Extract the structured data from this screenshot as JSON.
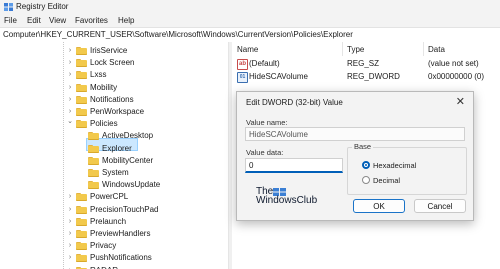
{
  "window": {
    "title": "Registry Editor"
  },
  "menu": [
    "File",
    "Edit",
    "View",
    "Favorites",
    "Help"
  ],
  "address": "Computer\\HKEY_CURRENT_USER\\Software\\Microsoft\\Windows\\CurrentVersion\\Policies\\Explorer",
  "tree": [
    {
      "label": "IrisService",
      "level": 0,
      "expanded": false
    },
    {
      "label": "Lock Screen",
      "level": 0,
      "expanded": false
    },
    {
      "label": "Lxss",
      "level": 0,
      "expanded": false
    },
    {
      "label": "Mobility",
      "level": 0,
      "expanded": false
    },
    {
      "label": "Notifications",
      "level": 0,
      "expanded": false
    },
    {
      "label": "PenWorkspace",
      "level": 0,
      "expanded": false
    },
    {
      "label": "Policies",
      "level": 0,
      "expanded": true
    },
    {
      "label": "ActiveDesktop",
      "level": 1,
      "expanded": null
    },
    {
      "label": "Explorer",
      "level": 1,
      "expanded": null,
      "selected": true
    },
    {
      "label": "MobilityCenter",
      "level": 1,
      "expanded": null
    },
    {
      "label": "System",
      "level": 1,
      "expanded": null
    },
    {
      "label": "WindowsUpdate",
      "level": 1,
      "expanded": null
    },
    {
      "label": "PowerCPL",
      "level": 0,
      "expanded": false
    },
    {
      "label": "PrecisionTouchPad",
      "level": 0,
      "expanded": false
    },
    {
      "label": "Prelaunch",
      "level": 0,
      "expanded": false
    },
    {
      "label": "PreviewHandlers",
      "level": 0,
      "expanded": false
    },
    {
      "label": "Privacy",
      "level": 0,
      "expanded": false
    },
    {
      "label": "PushNotifications",
      "level": 0,
      "expanded": false
    },
    {
      "label": "RADAR",
      "level": 0,
      "expanded": false
    }
  ],
  "values_pane": {
    "columns": [
      "Name",
      "Type",
      "Data"
    ],
    "rows": [
      {
        "icon": "string-value-icon",
        "name": "(Default)",
        "type": "REG_SZ",
        "data": "(value not set)"
      },
      {
        "icon": "binary-value-icon",
        "name": "HideSCAVolume",
        "type": "REG_DWORD",
        "data": "0x00000000 (0)"
      }
    ]
  },
  "dialog": {
    "title": "Edit DWORD (32-bit) Value",
    "value_name_label": "Value name:",
    "value_name": "HideSCAVolume",
    "value_data_label": "Value data:",
    "value_data": "0",
    "base_label": "Base",
    "radio_hex": "Hexadecimal",
    "radio_dec": "Decimal",
    "base_selected": "Hexadecimal",
    "ok": "OK",
    "cancel": "Cancel",
    "close_glyph": "✕"
  },
  "watermark": {
    "line1": "The",
    "line2": "WindowsClub"
  },
  "colors": {
    "accent": "#005fb8",
    "selection": "#cce8ff",
    "folder": "#f2c94c"
  }
}
